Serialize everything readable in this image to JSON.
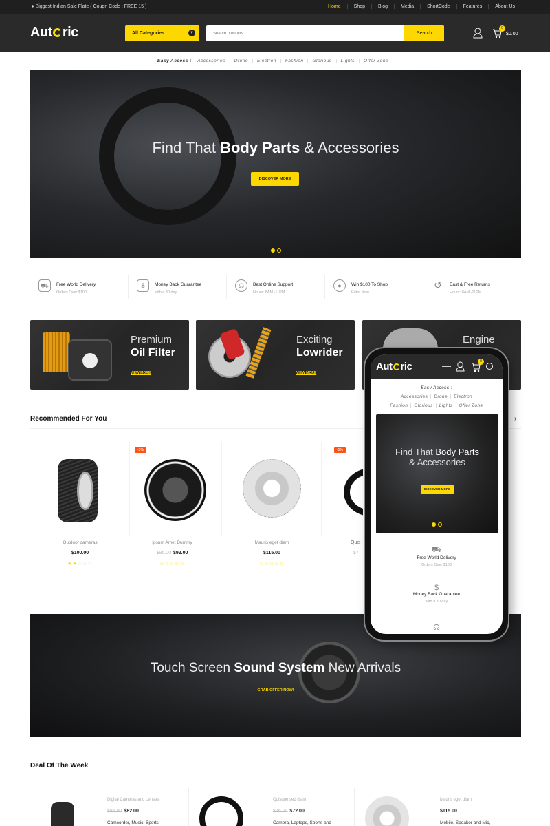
{
  "topbar": {
    "promo": "Biggest Indian Sale Flate ( Coupn Code : FREE 15 )",
    "nav": [
      "Home",
      "Shop",
      "Blog",
      "Media",
      "ShortCode",
      "Features",
      "About Us"
    ]
  },
  "header": {
    "logo": "Autoric",
    "category": "All Categories",
    "search_placeholder": "Search products...",
    "search_button": "Search",
    "cart_count": "0",
    "cart_total": "$0.00"
  },
  "easy_access": {
    "label": "Easy Access :",
    "links": [
      "Accessories",
      "Drone",
      "Electron",
      "Fashion",
      "Glorious",
      "Lights",
      "Offer Zone"
    ]
  },
  "hero": {
    "title_light": "Find That",
    "title_bold": "Body Parts",
    "title_rest": "& Accessories",
    "button": "DISCOVER MORE",
    "slides": 2,
    "active_slide": 1
  },
  "features": [
    {
      "icon": "truck-icon",
      "title": "Free World Delivery",
      "sub": "Orders Over $100"
    },
    {
      "icon": "money-bag-icon",
      "title": "Money Back Guarantee",
      "sub": "with a 30 day"
    },
    {
      "icon": "headset-icon",
      "title": "Best Online Support",
      "sub": "Hours: 8AM -11PM"
    },
    {
      "icon": "piggy-bank-icon",
      "title": "Win $100 To Shop",
      "sub": "Enter Now"
    },
    {
      "icon": "return-icon",
      "title": "East & Free Returns",
      "sub": "Hours: 8AM -11PM"
    }
  ],
  "banners": [
    {
      "line1": "Premium",
      "line2": "Oil Filter",
      "link": "VIEW MORE"
    },
    {
      "line1": "Exciting",
      "line2": "Lowrider",
      "link": "VIEW MORE"
    },
    {
      "line1": "Engine",
      "line2": "",
      "link": ""
    }
  ],
  "recommended": {
    "title": "Recommended For You",
    "products": [
      {
        "name": "Outdoor cameras",
        "old_price": "",
        "price": "$100.00",
        "rating": 2,
        "badge": ""
      },
      {
        "name": "Ipsum Amet Dummy",
        "old_price": "$95.00",
        "price": "$92.00",
        "rating": 0,
        "badge": "-3%"
      },
      {
        "name": "Mauris eget diam",
        "old_price": "",
        "price": "$115.00",
        "rating": 0,
        "badge": ""
      },
      {
        "name": "Quis",
        "old_price": "$7",
        "price": "",
        "rating": 0,
        "badge": "-5%"
      }
    ]
  },
  "sound_banner": {
    "title_light": "Touch Screen",
    "title_bold": "Sound System",
    "title_rest": "New Arrivals",
    "link": "GRAB OFFER NOW!"
  },
  "deals": {
    "title": "Deal Of The Week",
    "items": [
      {
        "category": "Digital Cameras and Lenses",
        "old_price": "$86.00",
        "price": "$82.00",
        "desc": "Camcorder, Music, Sports"
      },
      {
        "category": "Quisque sed diam",
        "old_price": "$76.00",
        "price": "$72.00",
        "desc": "Camera, Laptops, Sports and"
      },
      {
        "category": "Mauris eget diam",
        "old_price": "",
        "price": "$115.00",
        "desc": "Mobile, Speaker and Mic,"
      }
    ]
  },
  "mobile": {
    "logo": "Autoric",
    "cart_count": "0",
    "easy_label": "Easy Access :",
    "row1": [
      "Accessories",
      "Drone",
      "Electron"
    ],
    "row2": [
      "Fashion",
      "Glorious",
      "Lights",
      "Offer Zone"
    ],
    "hero_bold": "Body Parts",
    "hero_light": "Find That",
    "hero_rest": "& Accessories",
    "button": "DISCOVER MORE",
    "features": [
      {
        "title": "Free World Delivery",
        "sub": "Orders Over $100"
      },
      {
        "title": "Money Back Guarantee",
        "sub": "with a 30 day"
      }
    ]
  },
  "colors": {
    "accent": "#fcd800",
    "dark": "#2a2a2a",
    "sale": "#ff5316"
  }
}
